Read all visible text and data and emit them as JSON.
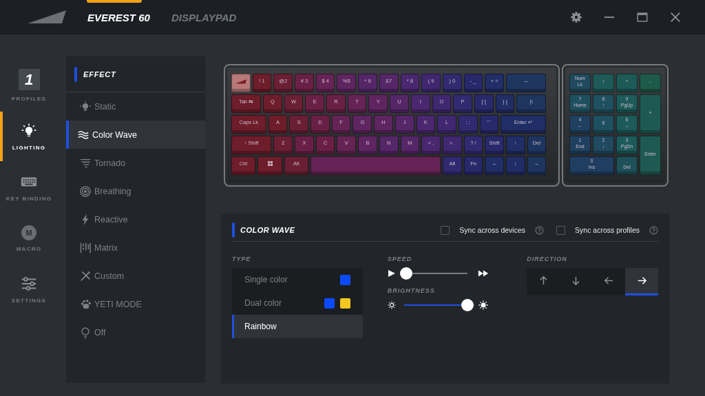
{
  "titlebar": {
    "tabs": [
      {
        "label": "EVEREST 60",
        "selected": true
      },
      {
        "label": "DISPLAYPAD",
        "selected": false
      }
    ]
  },
  "nav": [
    {
      "kind": "profile",
      "badge": "1",
      "label": "PROFILES",
      "selected": false
    },
    {
      "kind": "lighting",
      "label": "LIGHTING",
      "selected": true
    },
    {
      "kind": "keyboard",
      "label": "KEY BINDING",
      "selected": false
    },
    {
      "kind": "macro",
      "badge": "M",
      "label": "MACRO",
      "selected": false
    },
    {
      "kind": "settings",
      "label": "SETTINGS",
      "selected": false
    }
  ],
  "effects": {
    "title": "EFFECT",
    "items": [
      {
        "kind": "static",
        "label": "Static",
        "selected": false
      },
      {
        "kind": "wave",
        "label": "Color Wave",
        "selected": true
      },
      {
        "kind": "tornado",
        "label": "Tornado",
        "selected": false
      },
      {
        "kind": "breathing",
        "label": "Breathing",
        "selected": false
      },
      {
        "kind": "reactive",
        "label": "Reactive",
        "selected": false
      },
      {
        "kind": "matrix",
        "label": "Matrix",
        "selected": false
      },
      {
        "kind": "custom",
        "label": "Custom",
        "selected": false
      },
      {
        "kind": "paw",
        "label": "YETI MODE",
        "selected": false
      },
      {
        "kind": "off",
        "label": "Off",
        "selected": false
      }
    ]
  },
  "keyboard": {
    "main_rows": [
      {
        "keys": [
          {
            "kind": "logo",
            "color": "#b77878"
          },
          {
            "label": "! 1",
            "color": "#6e1d2a"
          },
          {
            "label": "@2",
            "color": "#6a1f35"
          },
          {
            "label": "# 3",
            "color": "#6a2045"
          },
          {
            "label": "$ 4",
            "color": "#652455"
          },
          {
            "label": "%5",
            "color": "#5e2560"
          },
          {
            "label": "^ 6",
            "color": "#552668"
          },
          {
            "label": "&7",
            "color": "#552668"
          },
          {
            "label": "* 8",
            "color": "#4a276e"
          },
          {
            "label": "( 9",
            "color": "#3f2870"
          },
          {
            "label": ") 0",
            "color": "#322a70"
          },
          {
            "label": "- _",
            "color": "#27296b"
          },
          {
            "label": "+ =",
            "color": "#202d66"
          },
          {
            "label": "←",
            "color": "#1e3560"
          }
        ]
      },
      {
        "keys": [
          {
            "label": "Tab ⇆",
            "color": "#6e1d2a"
          },
          {
            "label": "Q",
            "color": "#6e1d2a"
          },
          {
            "label": "W",
            "color": "#6a1f35"
          },
          {
            "label": "E",
            "color": "#6a2045"
          },
          {
            "label": "R",
            "color": "#6a2045"
          },
          {
            "label": "T",
            "color": "#652455"
          },
          {
            "label": "Y",
            "color": "#5e2560"
          },
          {
            "label": "U",
            "color": "#552668"
          },
          {
            "label": "I",
            "color": "#4a276e"
          },
          {
            "label": "O",
            "color": "#3f2870"
          },
          {
            "label": "P",
            "color": "#322a70"
          },
          {
            "label": "{ [",
            "color": "#27296b"
          },
          {
            "label": "} ]",
            "color": "#202d66"
          },
          {
            "label": "|\\",
            "color": "#1e3560"
          }
        ]
      },
      {
        "keys": [
          {
            "label": "Caps Lk",
            "color": "#6e1d2a"
          },
          {
            "label": "A",
            "color": "#6e1d2a"
          },
          {
            "label": "S",
            "color": "#6a1f35"
          },
          {
            "label": "D",
            "color": "#6a2045"
          },
          {
            "label": "F",
            "color": "#652455"
          },
          {
            "label": "G",
            "color": "#5e2560"
          },
          {
            "label": "H",
            "color": "#5e2560"
          },
          {
            "label": "J",
            "color": "#552668"
          },
          {
            "label": "K",
            "color": "#4a276e"
          },
          {
            "label": "L",
            "color": "#3f2870"
          },
          {
            "label": ": ;",
            "color": "#322a70"
          },
          {
            "label": "\" '",
            "color": "#27296b"
          },
          {
            "label": "Enter ↵",
            "color": "#202d66"
          }
        ]
      },
      {
        "keys": [
          {
            "label": "↑ Shift",
            "color": "#6e1d2a"
          },
          {
            "label": "Z",
            "color": "#6a1f35"
          },
          {
            "label": "X",
            "color": "#6a2045"
          },
          {
            "label": "C",
            "color": "#6a2045"
          },
          {
            "label": "V",
            "color": "#652455"
          },
          {
            "label": "B",
            "color": "#5e2560"
          },
          {
            "label": "N",
            "color": "#552668"
          },
          {
            "label": "M",
            "color": "#552668"
          },
          {
            "label": "< ,",
            "color": "#4a276e"
          },
          {
            "label": "> .",
            "color": "#3f2870"
          },
          {
            "label": "? /",
            "color": "#322a70"
          },
          {
            "label": "Shift",
            "color": "#27296b"
          },
          {
            "label": "↑",
            "color": "#202d66"
          },
          {
            "label": "Del",
            "color": "#1e3560"
          }
        ]
      },
      {
        "keys": [
          {
            "label": "Ctrl",
            "color": "#6e1d2a"
          },
          {
            "kind": "windows",
            "color": "#6e1d2a"
          },
          {
            "label": "Alt",
            "color": "#6a1f35"
          },
          {
            "kind": "space",
            "color": "#652455"
          },
          {
            "label": "Alt",
            "color": "#322a70"
          },
          {
            "label": "Fn",
            "color": "#27296b"
          },
          {
            "label": "←",
            "color": "#202d66"
          },
          {
            "label": "↓",
            "color": "#202d66"
          },
          {
            "label": "→",
            "color": "#1e3560"
          }
        ]
      }
    ],
    "numpad": [
      {
        "label": "Num\nLk",
        "color": "#1f4a5e"
      },
      {
        "label": "/",
        "color": "#1d5a58"
      },
      {
        "label": "*",
        "color": "#1d5a58"
      },
      {
        "label": "-",
        "color": "#1e5a48"
      },
      {
        "label": "7\nHome",
        "color": "#1f5060"
      },
      {
        "label": "8\n↑",
        "color": "#1f5060"
      },
      {
        "label": "9\nPgUp",
        "color": "#1d5a5a"
      },
      {
        "label": "+",
        "color": "#1e5a52"
      },
      {
        "label": "4\n←",
        "color": "#1f4060"
      },
      {
        "label": "5",
        "color": "#1f5060"
      },
      {
        "label": "6\n→",
        "color": "#1d5a5a"
      },
      {
        "label": "1\nEnd",
        "color": "#1f4060"
      },
      {
        "label": "2\n↓",
        "color": "#1f4a60"
      },
      {
        "label": "3\nPgDn",
        "color": "#1d5a5a"
      },
      {
        "label": "Enter",
        "color": "#1e5a52"
      },
      {
        "label": "0\nIns",
        "color": "#1f3e62"
      },
      {
        "label": ".\nDel",
        "color": "#1d5058"
      }
    ]
  },
  "panel": {
    "title": "COLOR WAVE",
    "sync": [
      {
        "label": "Sync across devices",
        "checked": false
      },
      {
        "label": "Sync across profiles",
        "checked": false
      }
    ],
    "type": {
      "label": "TYPE",
      "options": [
        {
          "label": "Single color",
          "selected": false,
          "swatches": [
            {
              "color": "#0a4bff"
            }
          ]
        },
        {
          "label": "Dual color",
          "selected": false,
          "swatches": [
            {
              "color": "#0a4bff"
            },
            {
              "color": "#f2c81e"
            }
          ]
        },
        {
          "label": "Rainbow",
          "selected": true
        }
      ]
    },
    "sliders": [
      {
        "kind": "speed",
        "label": "SPEED",
        "level": 0.04
      },
      {
        "kind": "brightness",
        "label": "BRIGHTNESS",
        "level": 1
      }
    ],
    "direction": {
      "label": "DIRECTION",
      "options": [
        {
          "kind": "up",
          "selected": false
        },
        {
          "kind": "down",
          "selected": false
        },
        {
          "kind": "left",
          "selected": false
        },
        {
          "kind": "right",
          "selected": true
        }
      ]
    }
  }
}
